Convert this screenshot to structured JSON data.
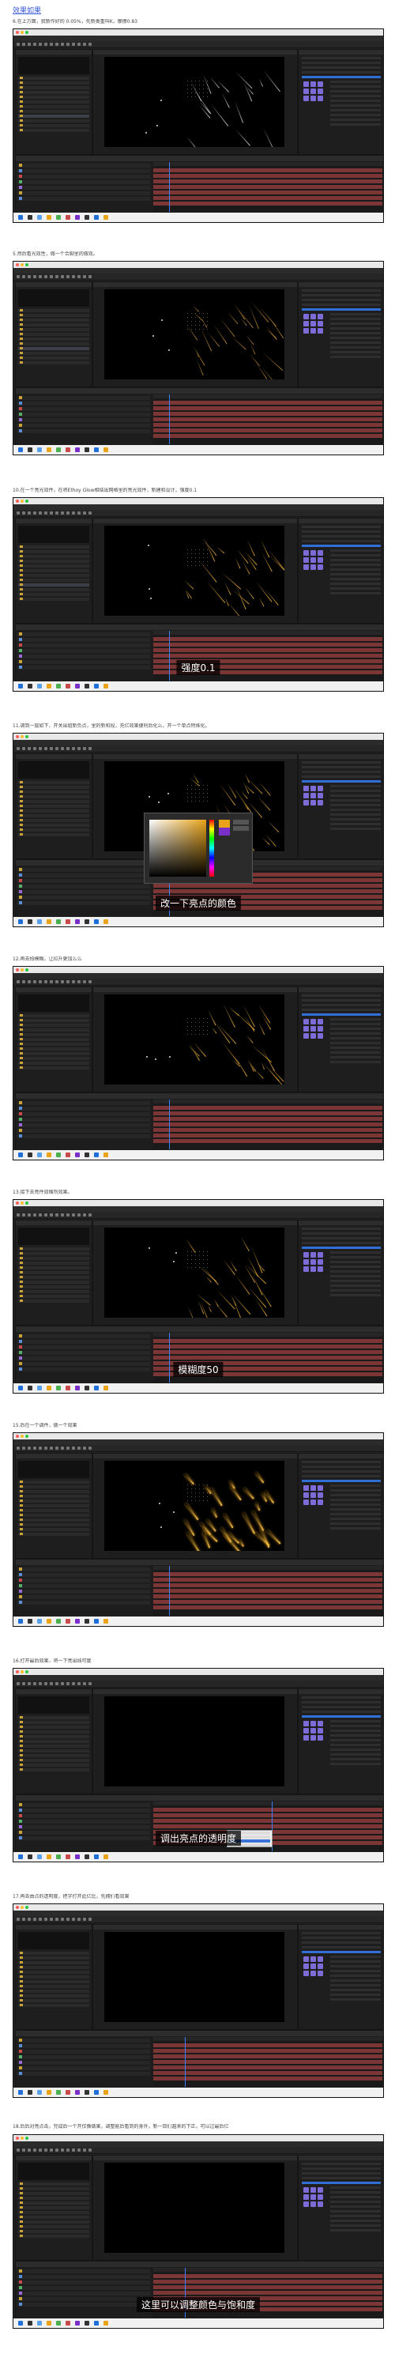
{
  "heading": "效果如果",
  "steps": [
    {
      "caption": "6.在上方面，我新作好的 0.05%，先新类重叫K，摩擦0.83",
      "subtitle": "",
      "glow": "none",
      "picker": false,
      "menu": false,
      "dark": false
    },
    {
      "caption": "5.然后看光效性，做一个合脚里的做效。",
      "subtitle": "",
      "glow": "low",
      "picker": false,
      "menu": false,
      "dark": false
    },
    {
      "caption": "10.在一个亮光效件，在将Ethoy Glow相结出网格里的亮光效件，新建和设计，强度0.1",
      "subtitle": "强度0.1",
      "glow": "mid",
      "picker": false,
      "menu": false,
      "dark": false
    },
    {
      "caption": "11.调到一层如下，开关出组新负点，里的新和段，充亿效果便利后化么，开一个单点特殊化。",
      "subtitle": "改一下亮点的颜色",
      "glow": "mid",
      "picker": true,
      "menu": false,
      "dark": false
    },
    {
      "caption": "12.再去拍模糊，让拉升更加么么",
      "subtitle": "",
      "glow": "mid",
      "picker": false,
      "menu": false,
      "dark": false
    },
    {
      "caption": "13.接下去亮件效缩剂效果。",
      "subtitle": "模糊度50",
      "glow": "mid",
      "picker": false,
      "menu": false,
      "dark": false
    },
    {
      "caption": "15.后在一个调件，做一个效果",
      "subtitle": "",
      "glow": "high",
      "picker": false,
      "menu": false,
      "dark": false
    },
    {
      "caption": "16.打开最后效果，将一下亮出线可度",
      "subtitle": "调出亮点的透明度",
      "glow": "none",
      "picker": false,
      "menu": true,
      "dark": true
    },
    {
      "caption": "17.再去由点的透明度，把字打开此亿比，先拥们看效果",
      "subtitle": "",
      "glow": "none",
      "picker": false,
      "menu": false,
      "dark": true
    },
    {
      "caption": "18.后后对亮点击，完成后一个开仅像做果，调整能后看到的身外，新一目们越来的下正，可以过最后亿",
      "subtitle": "这里可以调整颜色与饱和度",
      "glow": "none",
      "picker": false,
      "menu": false,
      "dark": true
    }
  ],
  "menu_items": [
    "文件",
    "编辑",
    "合成",
    "图层",
    "效果",
    "动画",
    "视图",
    "窗口",
    "帮助"
  ],
  "colors": {
    "accent": "#3a5bd9",
    "glow": "#e8a318",
    "timeline_bar": "#7c3636",
    "playhead": "#3f7dff"
  }
}
